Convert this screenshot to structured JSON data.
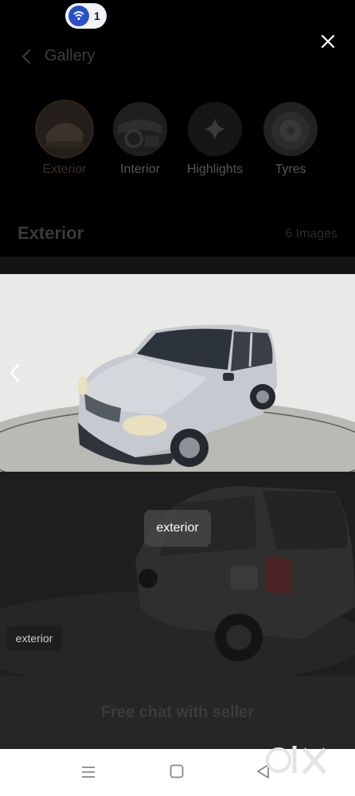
{
  "status": {
    "notification_count": "1"
  },
  "header": {
    "title": "Gallery"
  },
  "categories": [
    {
      "label": "Exterior",
      "active": true
    },
    {
      "label": "Interior",
      "active": false
    },
    {
      "label": "Highlights",
      "active": false
    },
    {
      "label": "Tyres",
      "active": false
    }
  ],
  "section": {
    "title": "Exterior",
    "count": "6 Images"
  },
  "gallery": {
    "tooltip": "exterior",
    "tag": "exterior"
  },
  "chat": {
    "label": "Free chat with seller"
  },
  "icons": [
    "back-icon",
    "close-icon",
    "sparkle-icon",
    "prev-arrow-icon",
    "menu-icon",
    "home-icon",
    "nav-back-icon",
    "olx-logo"
  ]
}
